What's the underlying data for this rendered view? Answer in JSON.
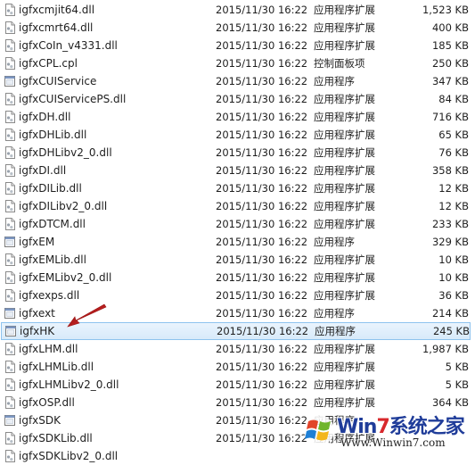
{
  "files": [
    {
      "name": "igfxcmjit64.dll",
      "date": "2015/11/30 16:22",
      "type": "应用程序扩展",
      "size": "1,523 KB",
      "icon": "dll-icon"
    },
    {
      "name": "igfxcmrt64.dll",
      "date": "2015/11/30 16:22",
      "type": "应用程序扩展",
      "size": "400 KB",
      "icon": "dll-icon"
    },
    {
      "name": "igfxCoIn_v4331.dll",
      "date": "2015/11/30 16:22",
      "type": "应用程序扩展",
      "size": "185 KB",
      "icon": "dll-icon"
    },
    {
      "name": "igfxCPL.cpl",
      "date": "2015/11/30 16:22",
      "type": "控制面板项",
      "size": "250 KB",
      "icon": "dll-icon"
    },
    {
      "name": "igfxCUIService",
      "date": "2015/11/30 16:22",
      "type": "应用程序",
      "size": "347 KB",
      "icon": "exe-icon"
    },
    {
      "name": "igfxCUIServicePS.dll",
      "date": "2015/11/30 16:22",
      "type": "应用程序扩展",
      "size": "84 KB",
      "icon": "dll-icon"
    },
    {
      "name": "igfxDH.dll",
      "date": "2015/11/30 16:22",
      "type": "应用程序扩展",
      "size": "716 KB",
      "icon": "dll-icon"
    },
    {
      "name": "igfxDHLib.dll",
      "date": "2015/11/30 16:22",
      "type": "应用程序扩展",
      "size": "65 KB",
      "icon": "dll-icon"
    },
    {
      "name": "igfxDHLibv2_0.dll",
      "date": "2015/11/30 16:22",
      "type": "应用程序扩展",
      "size": "76 KB",
      "icon": "dll-icon"
    },
    {
      "name": "igfxDI.dll",
      "date": "2015/11/30 16:22",
      "type": "应用程序扩展",
      "size": "358 KB",
      "icon": "dll-icon"
    },
    {
      "name": "igfxDILib.dll",
      "date": "2015/11/30 16:22",
      "type": "应用程序扩展",
      "size": "12 KB",
      "icon": "dll-icon"
    },
    {
      "name": "igfxDILibv2_0.dll",
      "date": "2015/11/30 16:22",
      "type": "应用程序扩展",
      "size": "12 KB",
      "icon": "dll-icon"
    },
    {
      "name": "igfxDTCM.dll",
      "date": "2015/11/30 16:22",
      "type": "应用程序扩展",
      "size": "233 KB",
      "icon": "dll-icon"
    },
    {
      "name": "igfxEM",
      "date": "2015/11/30 16:22",
      "type": "应用程序",
      "size": "329 KB",
      "icon": "exe-icon"
    },
    {
      "name": "igfxEMLib.dll",
      "date": "2015/11/30 16:22",
      "type": "应用程序扩展",
      "size": "10 KB",
      "icon": "dll-icon"
    },
    {
      "name": "igfxEMLibv2_0.dll",
      "date": "2015/11/30 16:22",
      "type": "应用程序扩展",
      "size": "10 KB",
      "icon": "dll-icon"
    },
    {
      "name": "igfxexps.dll",
      "date": "2015/11/30 16:22",
      "type": "应用程序扩展",
      "size": "36 KB",
      "icon": "dll-icon"
    },
    {
      "name": "igfxext",
      "date": "2015/11/30 16:22",
      "type": "应用程序",
      "size": "214 KB",
      "icon": "exe-icon"
    },
    {
      "name": "igfxHK",
      "date": "2015/11/30 16:22",
      "type": "应用程序",
      "size": "245 KB",
      "icon": "exe-icon",
      "selected": true
    },
    {
      "name": "igfxLHM.dll",
      "date": "2015/11/30 16:22",
      "type": "应用程序扩展",
      "size": "1,987 KB",
      "icon": "dll-icon"
    },
    {
      "name": "igfxLHMLib.dll",
      "date": "2015/11/30 16:22",
      "type": "应用程序扩展",
      "size": "5 KB",
      "icon": "dll-icon"
    },
    {
      "name": "igfxLHMLibv2_0.dll",
      "date": "2015/11/30 16:22",
      "type": "应用程序扩展",
      "size": "5 KB",
      "icon": "dll-icon"
    },
    {
      "name": "igfxOSP.dll",
      "date": "2015/11/30 16:22",
      "type": "应用程序扩展",
      "size": "364 KB",
      "icon": "dll-icon"
    },
    {
      "name": "igfxSDK",
      "date": "2015/11/30 16:22",
      "type": "应用程序",
      "size": "",
      "icon": "exe-icon"
    },
    {
      "name": "igfxSDKLib.dll",
      "date": "2015/11/30 16:22",
      "type": "应用程序扩展",
      "size": "",
      "icon": "dll-icon"
    },
    {
      "name": "igfxSDKLibv2_0.dll",
      "date": "",
      "type": "",
      "size": "",
      "icon": "dll-icon"
    }
  ],
  "annotation": {
    "icon": "red-arrow-icon",
    "color": "#d42020"
  },
  "watermark": {
    "brand_prefix": "Win",
    "brand_seven": "7",
    "brand_suffix": "系统之家",
    "url": "Www.Winwin7.com",
    "icon": "windows-logo-icon"
  },
  "colors": {
    "selection_fill": "#dcebfb",
    "selection_border": "#8ec3ee",
    "text": "#1e1e1e"
  }
}
